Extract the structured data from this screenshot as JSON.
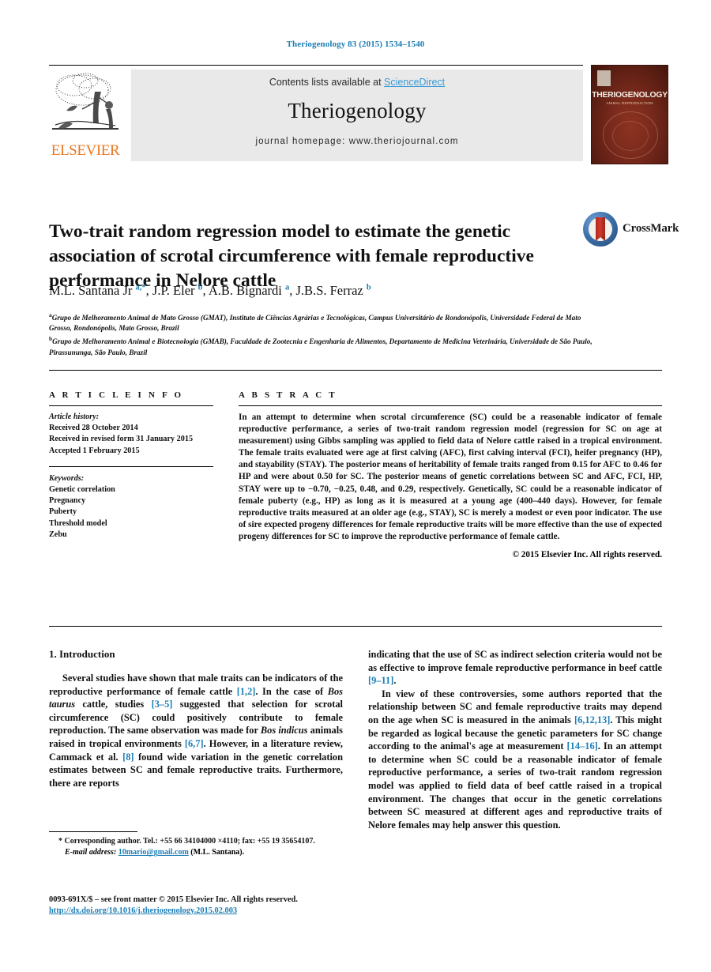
{
  "running_head": "Theriogenology 83 (2015) 1534–1540",
  "masthead": {
    "contents_prefix": "Contents lists available at ",
    "sciencedirect": "ScienceDirect",
    "journal_title": "Theriogenology",
    "homepage": "journal homepage: www.theriojournal.com",
    "publisher_name": "ELSEVIER",
    "cover_title": "THERIOGENOLOGY",
    "cover_subtitle": "ANIMAL REPRODUCTION"
  },
  "article": {
    "title": "Two-trait random regression model to estimate the genetic association of scrotal circumference with female reproductive performance in Nelore cattle",
    "crossmark_label": "CrossMark",
    "authors_html": "M.L. Santana Jr <sup class=\"sup\">a,*</sup>, J.P. Eler <sup class=\"sup\">b</sup>, A.B. Bignardi <sup class=\"sup\">a</sup>, J.B.S. Ferraz <sup class=\"sup\">b</sup>",
    "affiliations": [
      "Grupo de Melhoramento Animal de Mato Grosso (GMAT), Instituto de Ciências Agrárias e Tecnológicas, Campus Universitário de Rondonópolis, Universidade Federal de Mato Grosso, Rondonópolis, Mato Grosso, Brazil",
      "Grupo de Melhoramento Animal e Biotecnologia (GMAB), Faculdade de Zootecnia e Engenharia de Alimentos, Departamento de Medicina Veterinária, Universidade de São Paulo, Pirassununga, São Paulo, Brazil"
    ],
    "affiliation_marks": [
      "a",
      "b"
    ]
  },
  "article_info": {
    "heading": "A R T I C L E  I N F O",
    "history_label": "Article history:",
    "history": [
      "Received 28 October 2014",
      "Received in revised form 31 January 2015",
      "Accepted 1 February 2015"
    ],
    "keywords_label": "Keywords:",
    "keywords": [
      "Genetic correlation",
      "Pregnancy",
      "Puberty",
      "Threshold model",
      "Zebu"
    ]
  },
  "abstract": {
    "heading": "A B S T R A C T",
    "text": "In an attempt to determine when scrotal circumference (SC) could be a reasonable indicator of female reproductive performance, a series of two-trait random regression model (regression for SC on age at measurement) using Gibbs sampling was applied to field data of Nelore cattle raised in a tropical environment. The female traits evaluated were age at first calving (AFC), first calving interval (FCI), heifer pregnancy (HP), and stayability (STAY). The posterior means of heritability of female traits ranged from 0.15 for AFC to 0.46 for HP and were about 0.50 for SC. The posterior means of genetic correlations between SC and AFC, FCI, HP, STAY were up to −0.70, −0.25, 0.48, and 0.29, respectively. Genetically, SC could be a reasonable indicator of female puberty (e.g., HP) as long as it is measured at a young age (400–440 days). However, for female reproductive traits measured at an older age (e.g., STAY), SC is merely a modest or even poor indicator. The use of sire expected progeny differences for female reproductive traits will be more effective than the use of expected progeny differences for SC to improve the reproductive performance of female cattle.",
    "copyright": "© 2015 Elsevier Inc. All rights reserved."
  },
  "body": {
    "section_heading": "1. Introduction",
    "left_paragraph_1_html": "Several studies have shown that male traits can be indicators of the reproductive performance of female cattle <span class=\"ref\">[1,2]</span>. In the case of <span class=\"it\">Bos taurus</span> cattle, studies <span class=\"ref\">[3–5]</span> suggested that selection for scrotal circumference (SC) could positively contribute to female reproduction. The same observation was made for <span class=\"it\">Bos indicus</span> animals raised in tropical environments <span class=\"ref\">[6,7]</span>. However, in a literature review, Cammack et al. <span class=\"ref\">[8]</span> found wide variation in the genetic correlation estimates between SC and female reproductive traits. Furthermore, there are reports",
    "right_paragraph_1_html": "indicating that the use of SC as indirect selection criteria would not be as effective to improve female reproductive performance in beef cattle <span class=\"ref\">[9–11]</span>.",
    "right_paragraph_2_html": "In view of these controversies, some authors reported that the relationship between SC and female reproductive traits may depend on the age when SC is measured in the animals <span class=\"ref\">[6,12,13]</span>. This might be regarded as logical because the genetic parameters for SC change according to the animal's age at measurement <span class=\"ref\">[14–16]</span>. In an attempt to determine when SC could be a reasonable indicator of female reproductive performance, a series of two-trait random regression model was applied to field data of beef cattle raised in a tropical environment. The changes that occur in the genetic correlations between SC measured at different ages and reproductive traits of Nelore females may help answer this question."
  },
  "footnotes": {
    "corresponding_html": "<span class=\"lead\">* Corresponding author. Tel.: +55 66 34104000 ×4110; fax: +55 19 35654107.</span>",
    "email_label": "E-mail address:",
    "email": "10mario@gmail.com",
    "email_owner": "(M.L. Santana).",
    "issn_line": "0093-691X/$ – see front matter © 2015 Elsevier Inc. All rights reserved.",
    "doi": "http://dx.doi.org/10.1016/j.theriogenology.2015.02.003"
  }
}
